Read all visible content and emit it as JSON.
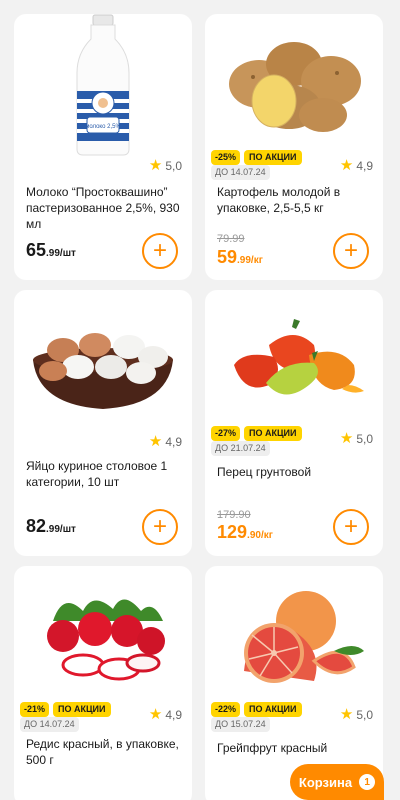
{
  "products": [
    {
      "title": "Молоко “Простоквашино” пастеризованное 2,5%, 930 мл",
      "rating": "5,0",
      "price_main": "65",
      "price_frac": ".99/шт",
      "old_price": null,
      "discount": null,
      "promo_label": null,
      "until": null,
      "image_icon": "milk-bottle-icon",
      "bottle_label": "молоко 2,5%"
    },
    {
      "title": "Картофель молодой в упаковке, 2,5-5,5 кг",
      "rating": "4,9",
      "price_main": "59",
      "price_frac": ".99/кг",
      "old_price": "79.99",
      "discount": "-25%",
      "promo_label": "ПО АКЦИИ",
      "until": "ДО 14.07.24",
      "image_icon": "potato-icon"
    },
    {
      "title": "Яйцо куриное столовое 1 категории, 10 шт",
      "rating": "4,9",
      "price_main": "82",
      "price_frac": ".99/шт",
      "old_price": null,
      "discount": null,
      "promo_label": null,
      "until": null,
      "image_icon": "eggs-bowl-icon"
    },
    {
      "title": "Перец грунтовой",
      "rating": "5,0",
      "price_main": "129",
      "price_frac": ".90/кг",
      "old_price": "179.90",
      "discount": "-27%",
      "promo_label": "ПО АКЦИИ",
      "until": "ДО 21.07.24",
      "image_icon": "pepper-icon"
    },
    {
      "title": "Редис красный, в упаковке, 500 г",
      "rating": "4,9",
      "price_main": null,
      "price_frac": null,
      "old_price": null,
      "discount": "-21%",
      "promo_label": "ПО АКЦИИ",
      "until": "ДО 14.07.24",
      "image_icon": "radish-icon"
    },
    {
      "title": "Грейпфрут красный",
      "rating": "5,0",
      "price_main": null,
      "price_frac": null,
      "old_price": null,
      "discount": "-22%",
      "promo_label": "ПО АКЦИИ",
      "until": "ДО 15.07.24",
      "image_icon": "grapefruit-icon"
    }
  ],
  "add_symbol": "+",
  "star_symbol": "★",
  "cart": {
    "label": "Корзина",
    "count": "1"
  },
  "colors": {
    "accent": "#ff8a00",
    "badge": "#ffd400",
    "star": "#ffc400"
  }
}
